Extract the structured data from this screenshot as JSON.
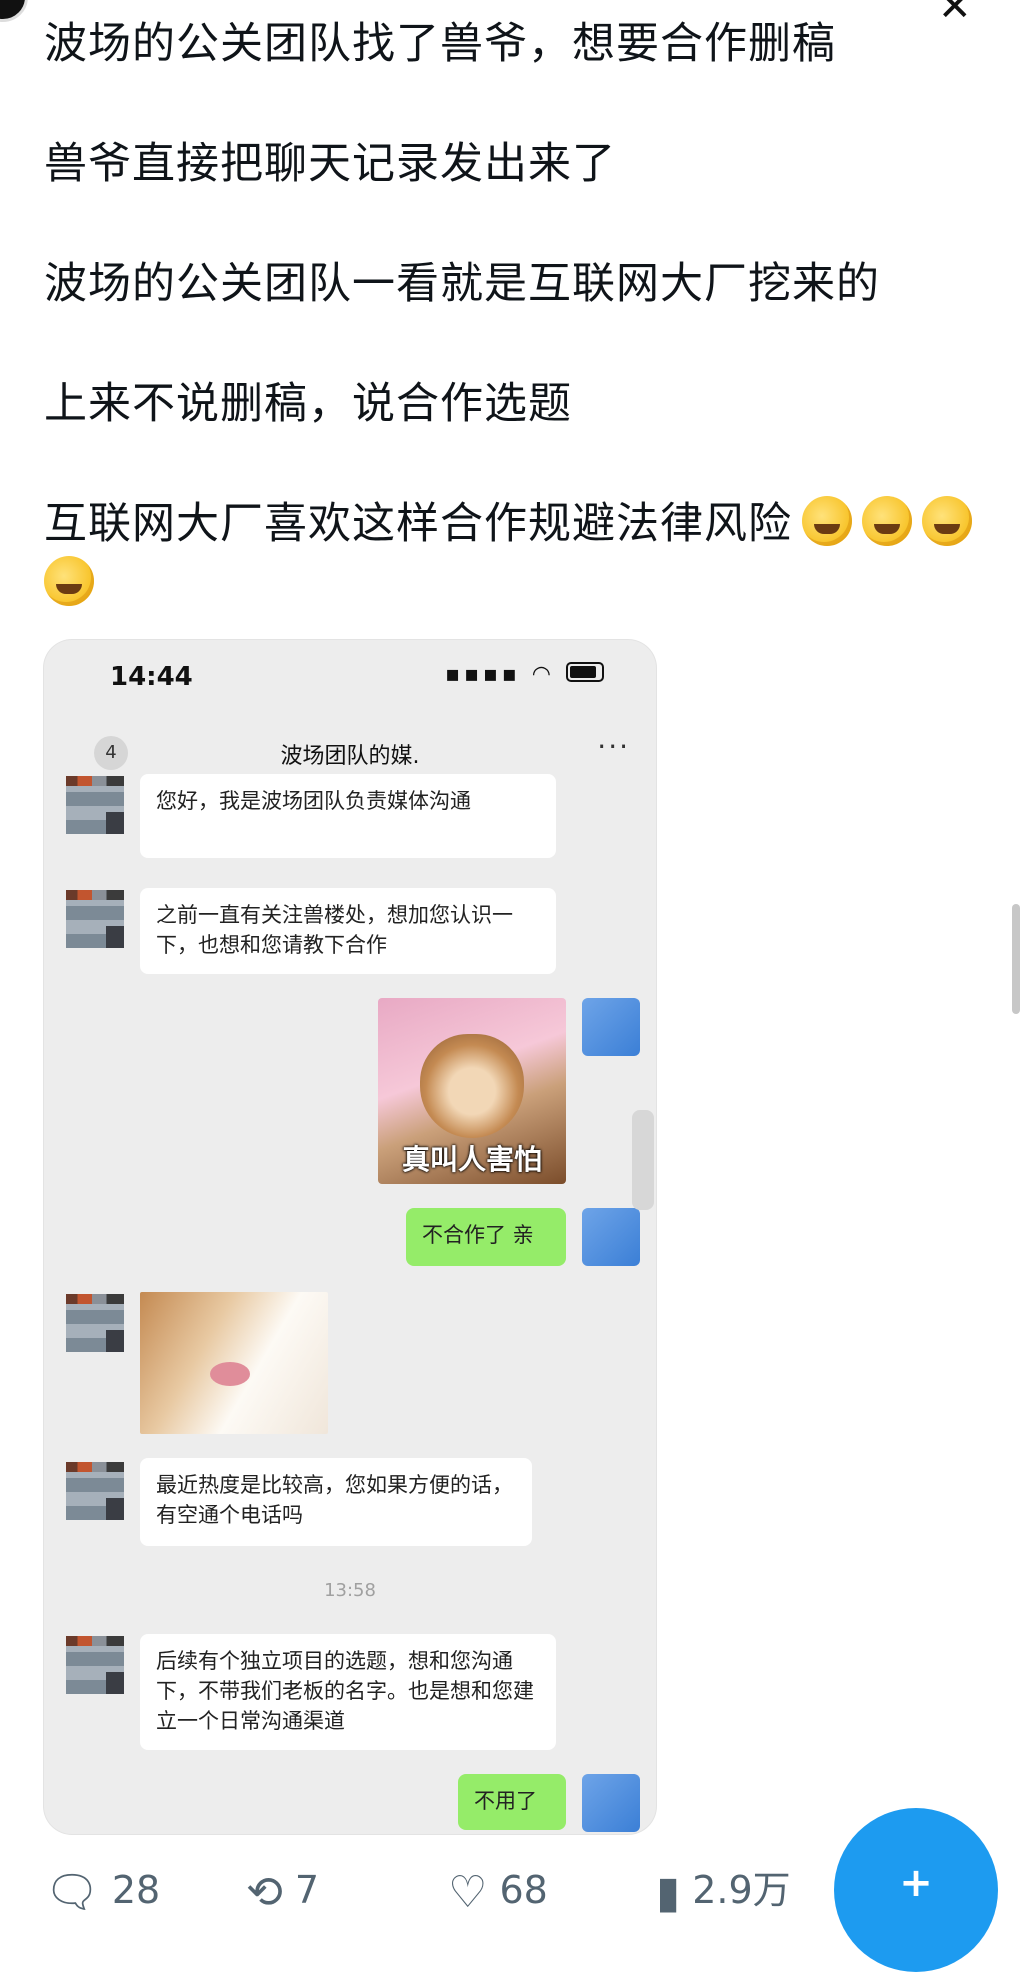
{
  "post": {
    "lines": [
      "波场的公关团队找了兽爷，想要合作删稿",
      "兽爷直接把聊天记录发出来了",
      "波场的公关团队一看就是互联网大厂挖来的",
      "上来不说删稿，说合作选题",
      "互联网大厂喜欢这样合作规避法律风险"
    ]
  },
  "screenshot": {
    "time": "14:44",
    "back_count": "4",
    "chat_title": "波场团队的媒.",
    "messages": [
      "您好，我是波场团队负责媒体沟通",
      "之前一直有关注兽楼处，想加您认识一下，也想和您请教下合作",
      "不合作了 亲",
      "最近热度是比较高，您如果方便的话，有空通个电话吗",
      "后续有个独立项目的选题，想和您沟通下，不带我们老板的名字。也是想和您建立一个日常沟通渠道",
      "不用了"
    ],
    "dog_caption": "真叫人害怕",
    "timestamp": "13:58"
  },
  "actions": {
    "replies": "28",
    "retweets": "7",
    "likes": "68",
    "views": "2.9万"
  },
  "icons": {
    "reply": "reply-icon",
    "retweet": "retweet-icon",
    "like": "heart-icon",
    "views": "views-icon",
    "compose": "compose-icon"
  }
}
